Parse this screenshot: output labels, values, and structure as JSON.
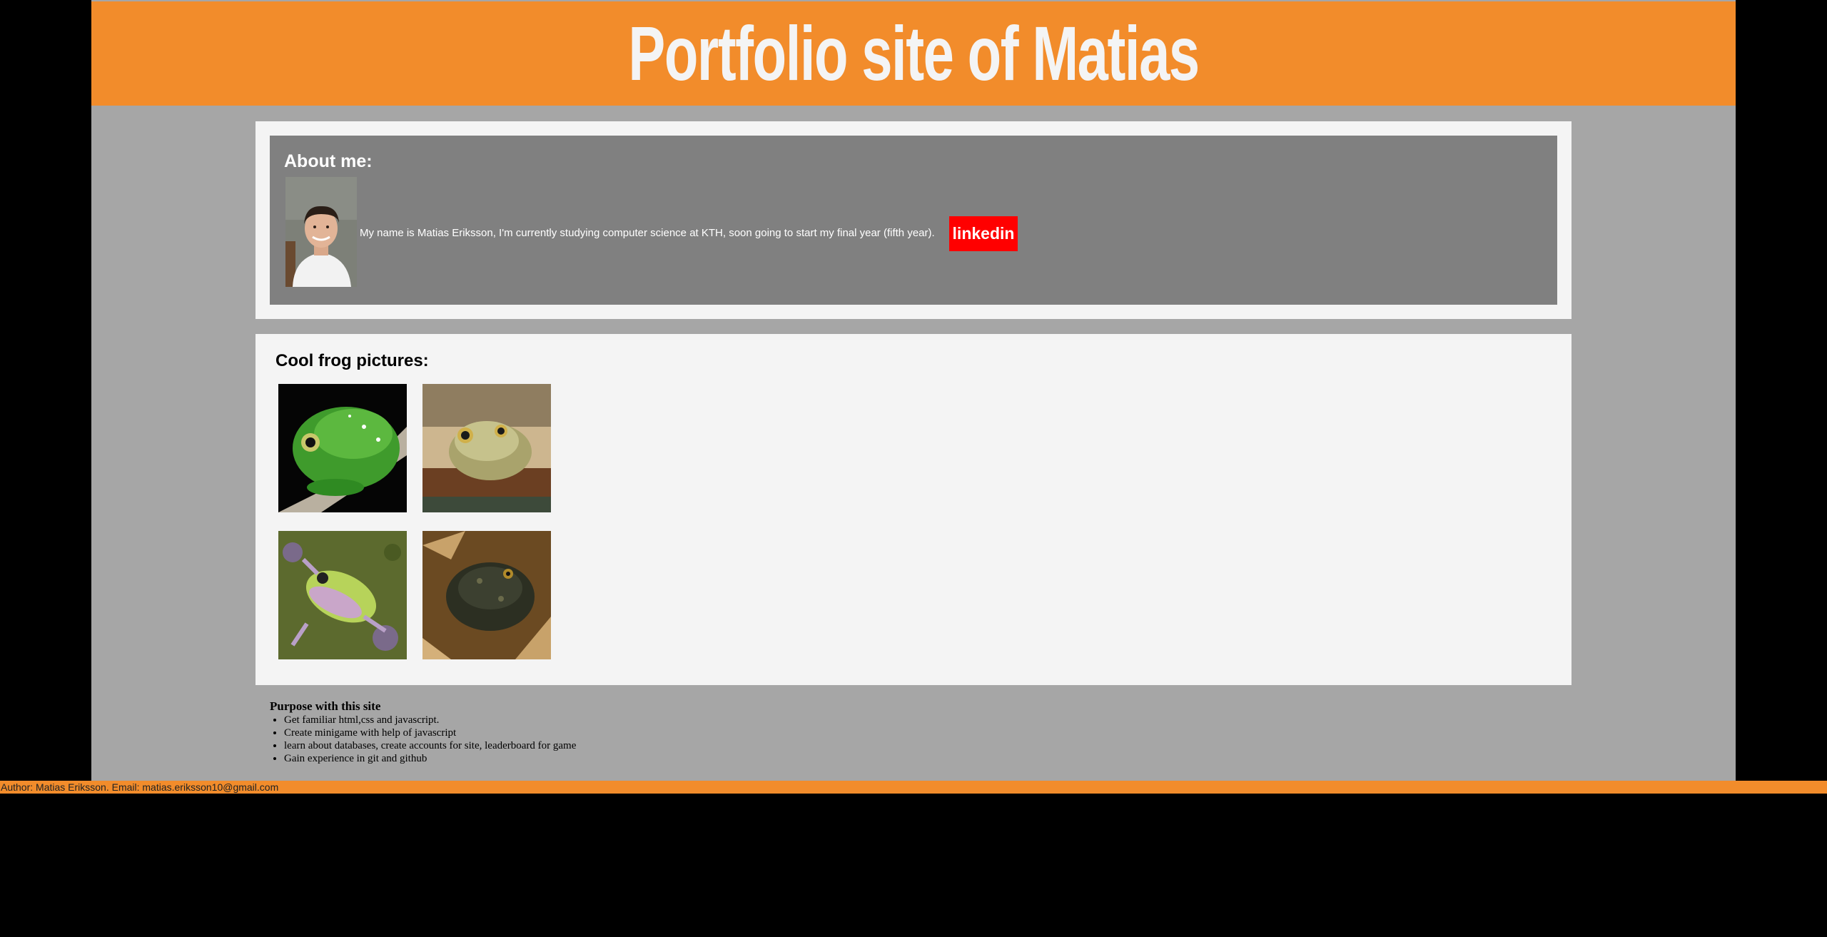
{
  "header": {
    "title": "Portfolio site of Matias"
  },
  "about": {
    "title": "About me:",
    "text": "My name is Matias Eriksson, I'm currently studying computer science at KTH, soon going to start my final year (fifth year).",
    "linkedin_label": "linkedin"
  },
  "frogs": {
    "title": "Cool frog pictures:"
  },
  "purpose": {
    "title": "Purpose with this site",
    "items": [
      "Get familiar html,css and javascript.",
      "Create minigame with help of javascript",
      "learn about databases, create accounts for site, leaderboard for game",
      "Gain experience in git and github"
    ]
  },
  "footer": {
    "text": "Author: Matias Eriksson. Email: matias.eriksson10@gmail.com"
  },
  "colors": {
    "header_bg": "#f28c2b",
    "page_bg": "#a6a6a6",
    "panel_bg": "#f4f4f4",
    "about_bg": "#808080",
    "linkedin_bg": "#ff0000"
  }
}
